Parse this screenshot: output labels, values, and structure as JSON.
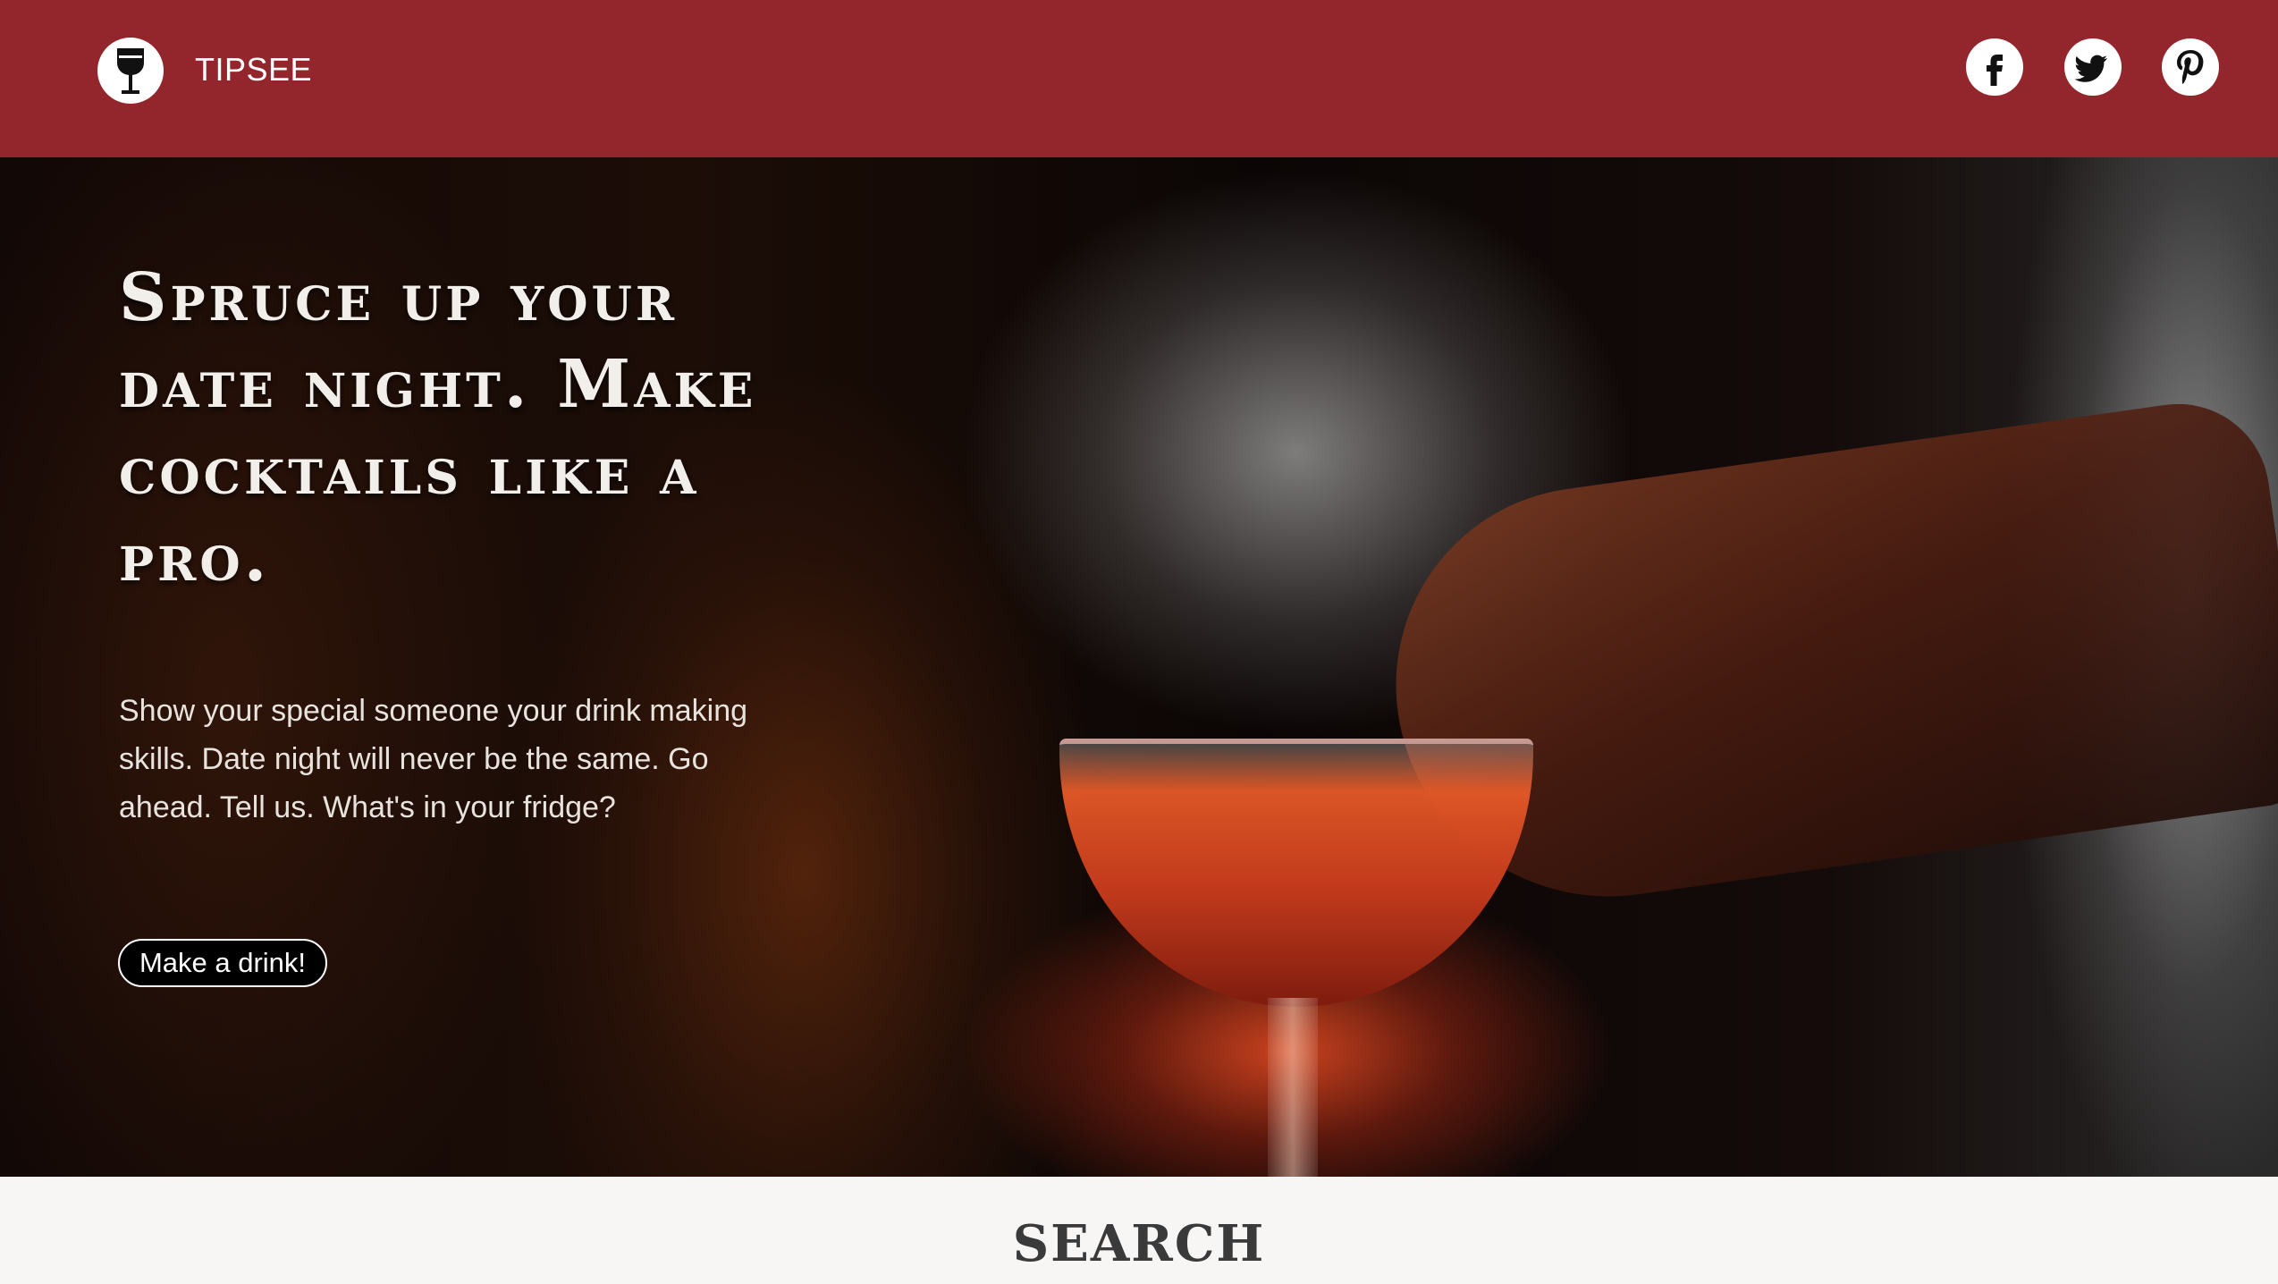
{
  "header": {
    "brand": "TIPSEE",
    "logo_icon": "wine-glass-icon",
    "social": [
      "facebook-icon",
      "twitter-icon",
      "pinterest-icon"
    ],
    "colors": {
      "background": "#93262c"
    }
  },
  "hero": {
    "title": "Spruce up your date night. Make cocktails like a pro.",
    "body": "Show your special someone your drink making skills. Date night will never be the same. Go ahead. Tell us. What's in your fridge?",
    "cta_label": "Make a drink!"
  },
  "search": {
    "title": "SEARCH"
  }
}
